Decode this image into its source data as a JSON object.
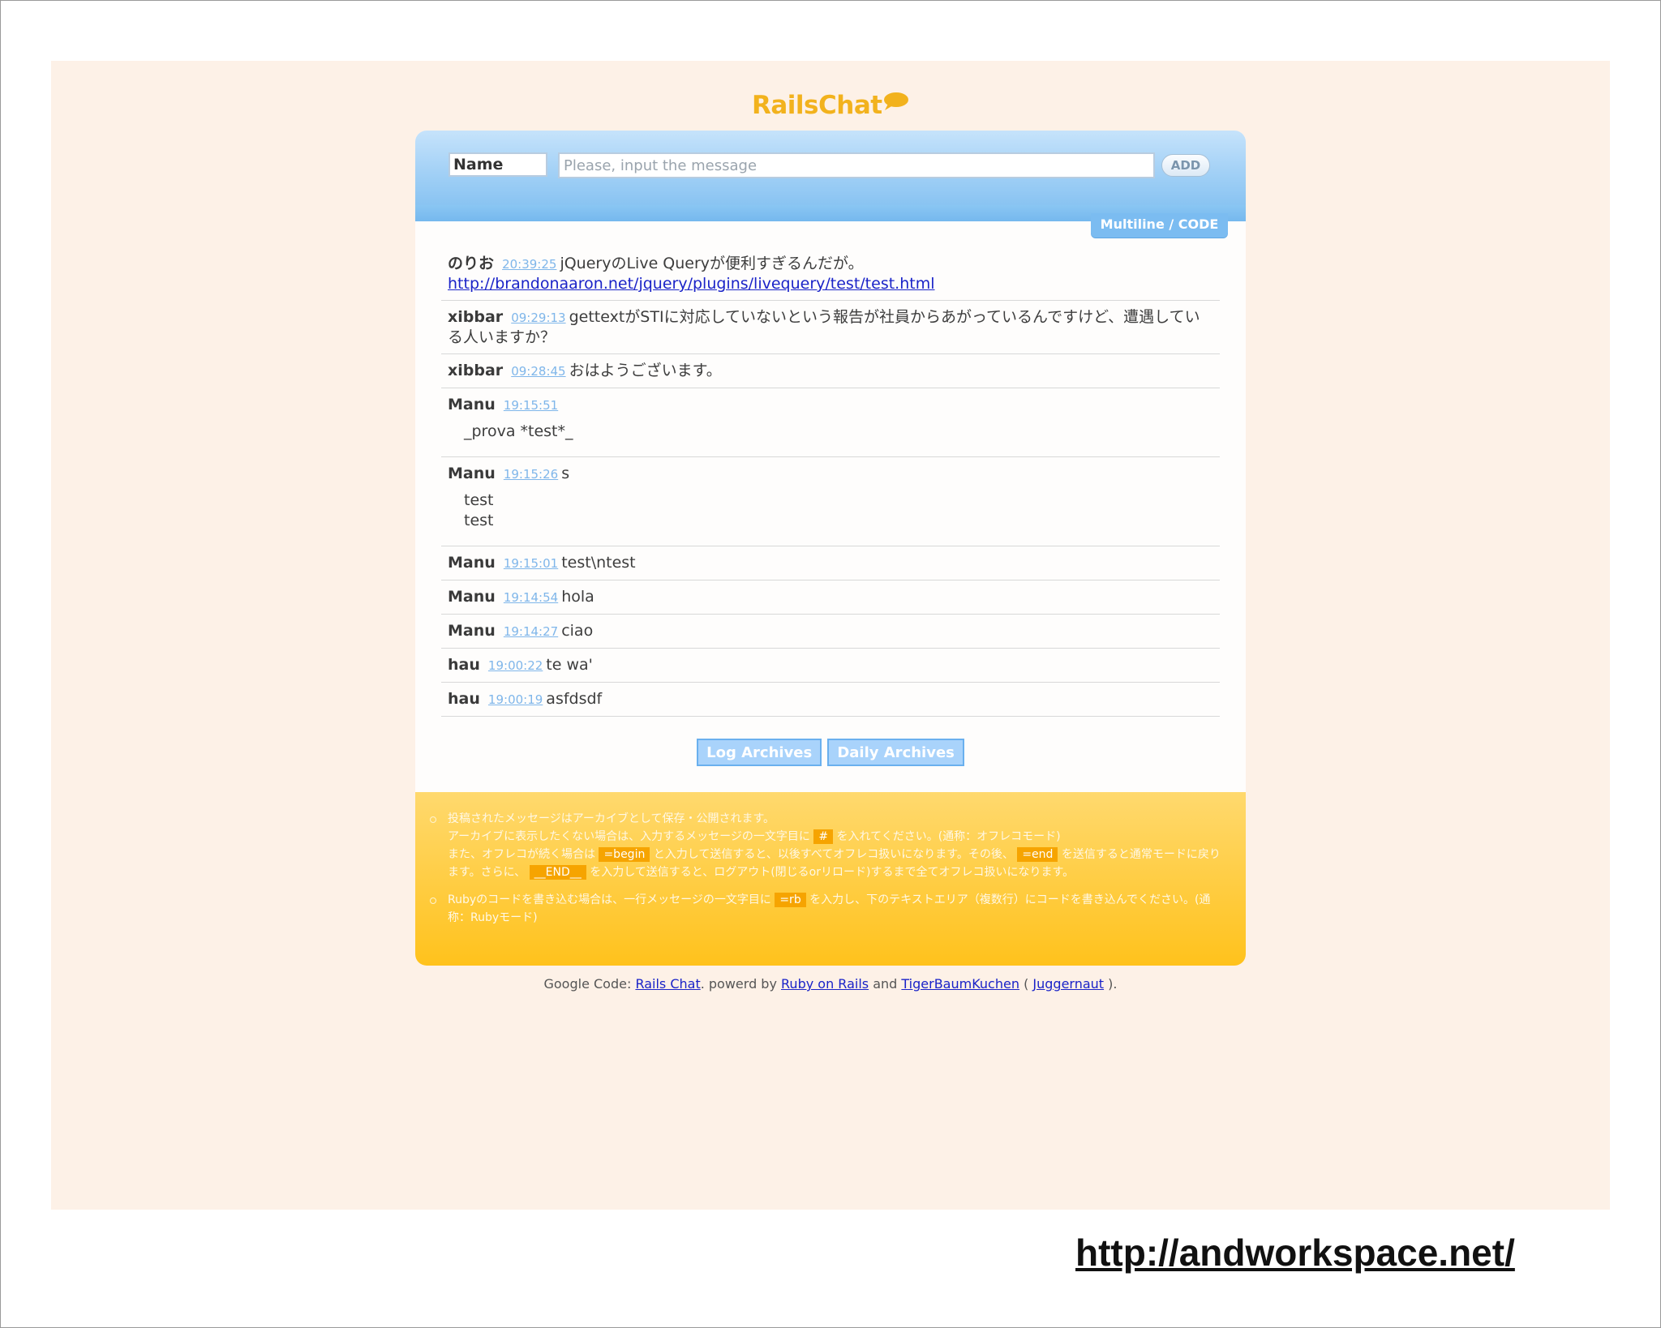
{
  "app": {
    "title": "RailsChat"
  },
  "form": {
    "name_value": "Name",
    "message_placeholder": "Please, input the message",
    "add_label": "ADD",
    "multiline_label": "Multiline / CODE"
  },
  "messages": [
    {
      "author": "のりお",
      "time": "20:39:25",
      "text": "jQueryのLive Queryが便利すぎるんだが。",
      "link": "http://brandonaaron.net/jquery/plugins/livequery/test/test.html"
    },
    {
      "author": "xibbar",
      "time": "09:29:13",
      "text": "gettextがSTIに対応していないという報告が社員からあがっているんですけど、遭遇している人いますか？"
    },
    {
      "author": "xibbar",
      "time": "09:28:45",
      "text": "おはようございます。"
    },
    {
      "author": "Manu",
      "time": "19:15:51",
      "text": "",
      "block": "_prova *test*_"
    },
    {
      "author": "Manu",
      "time": "19:15:26",
      "text": "s",
      "block_line1": "test",
      "block_line2": "test"
    },
    {
      "author": "Manu",
      "time": "19:15:01",
      "text": "test\\ntest"
    },
    {
      "author": "Manu",
      "time": "19:14:54",
      "text": "hola"
    },
    {
      "author": "Manu",
      "time": "19:14:27",
      "text": "ciao"
    },
    {
      "author": "hau",
      "time": "19:00:22",
      "text": "te wa'"
    },
    {
      "author": "hau",
      "time": "19:00:19",
      "text": "asfdsdf"
    }
  ],
  "archives": {
    "log_label": "Log Archives",
    "daily_label": "Daily Archives"
  },
  "notes": {
    "n1_a": "投稿されたメッセージはアーカイブとして保存・公開されます。",
    "n1_b": "アーカイブに表示したくない場合は、入力するメッセージの一文字目に",
    "tag_hash": "#",
    "n1_c": "を入れてください。(通称：オフレコモード)",
    "n1_d": "また、オフレコが続く場合は",
    "tag_begin": "=begin",
    "n1_e": "と入力して送信すると、以後すべてオフレコ扱いになります。その後、",
    "tag_end": "=end",
    "n1_f": "を送信すると通常モードに戻ります。さらに、",
    "tag_END": "__END__",
    "n1_g": "を入力して送信すると、ログアウト(閉じるorリロード)するまで全てオフレコ扱いになります。",
    "n2_a": "Rubyのコードを書き込む場合は、一行メッセージの一文字目に",
    "tag_rb": "=rb",
    "n2_b": "を入力し、下のテキストエリア（複数行）にコードを書き込んでください。(通称：Rubyモード)"
  },
  "credits": {
    "prefix": "Google Code:",
    "rails_chat": "Rails Chat",
    "powerd": ". powerd by",
    "ror": "Ruby on Rails",
    "and": "and",
    "tiger": "TigerBaumKuchen",
    "paren_open": "(",
    "juggernaut": "Juggernaut",
    "paren_close": ")."
  },
  "site_url": "http://andworkspace.net/",
  "colors": {
    "logo": "#f2b21d",
    "header_blue": "#7dbdf0",
    "footer_yellow": "#ffc21c",
    "background": "#fdf1e7"
  }
}
